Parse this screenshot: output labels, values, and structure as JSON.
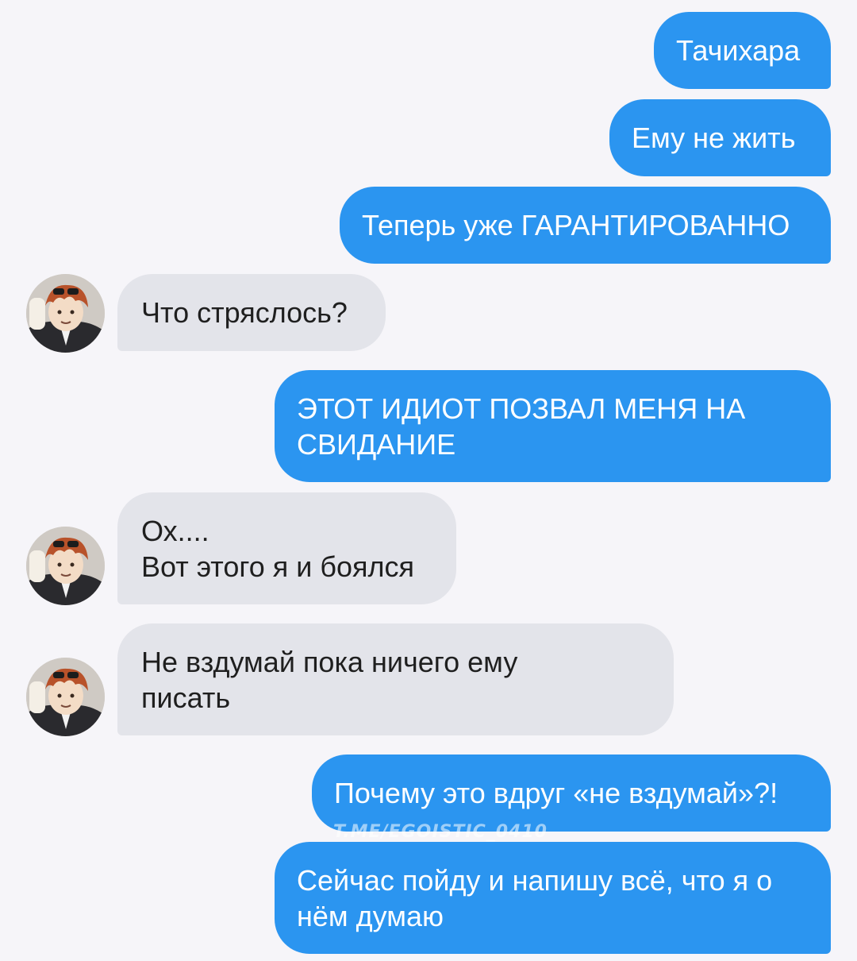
{
  "messages": [
    {
      "side": "out",
      "text": "Тачихара"
    },
    {
      "side": "out",
      "text": "Ему не жить"
    },
    {
      "side": "out",
      "text": "Теперь уже ГАРАНТИРОВАННО"
    },
    {
      "side": "in",
      "text": "Что стряслось?"
    },
    {
      "side": "out",
      "text": "ЭТОТ ИДИОТ ПОЗВАЛ МЕНЯ НА\nСВИДАНИЕ"
    },
    {
      "side": "in",
      "text": "Ох....\nВот этого я и боялся"
    },
    {
      "side": "in",
      "text": "Не вздумай пока ничего ему\nписать"
    },
    {
      "side": "out",
      "text": "Почему это вдруг «не вздумай»?!"
    },
    {
      "side": "out",
      "text": "Сейчас пойду и напишу всё, что я о\nнём думаю"
    }
  ],
  "contact": {
    "avatar_icon": "contact-avatar-icon"
  },
  "watermark": "t.me/egoistic_0410",
  "colors": {
    "outgoing_bubble": "#2b95f0",
    "incoming_bubble": "#e3e4ea",
    "background": "#f6f5f9"
  }
}
